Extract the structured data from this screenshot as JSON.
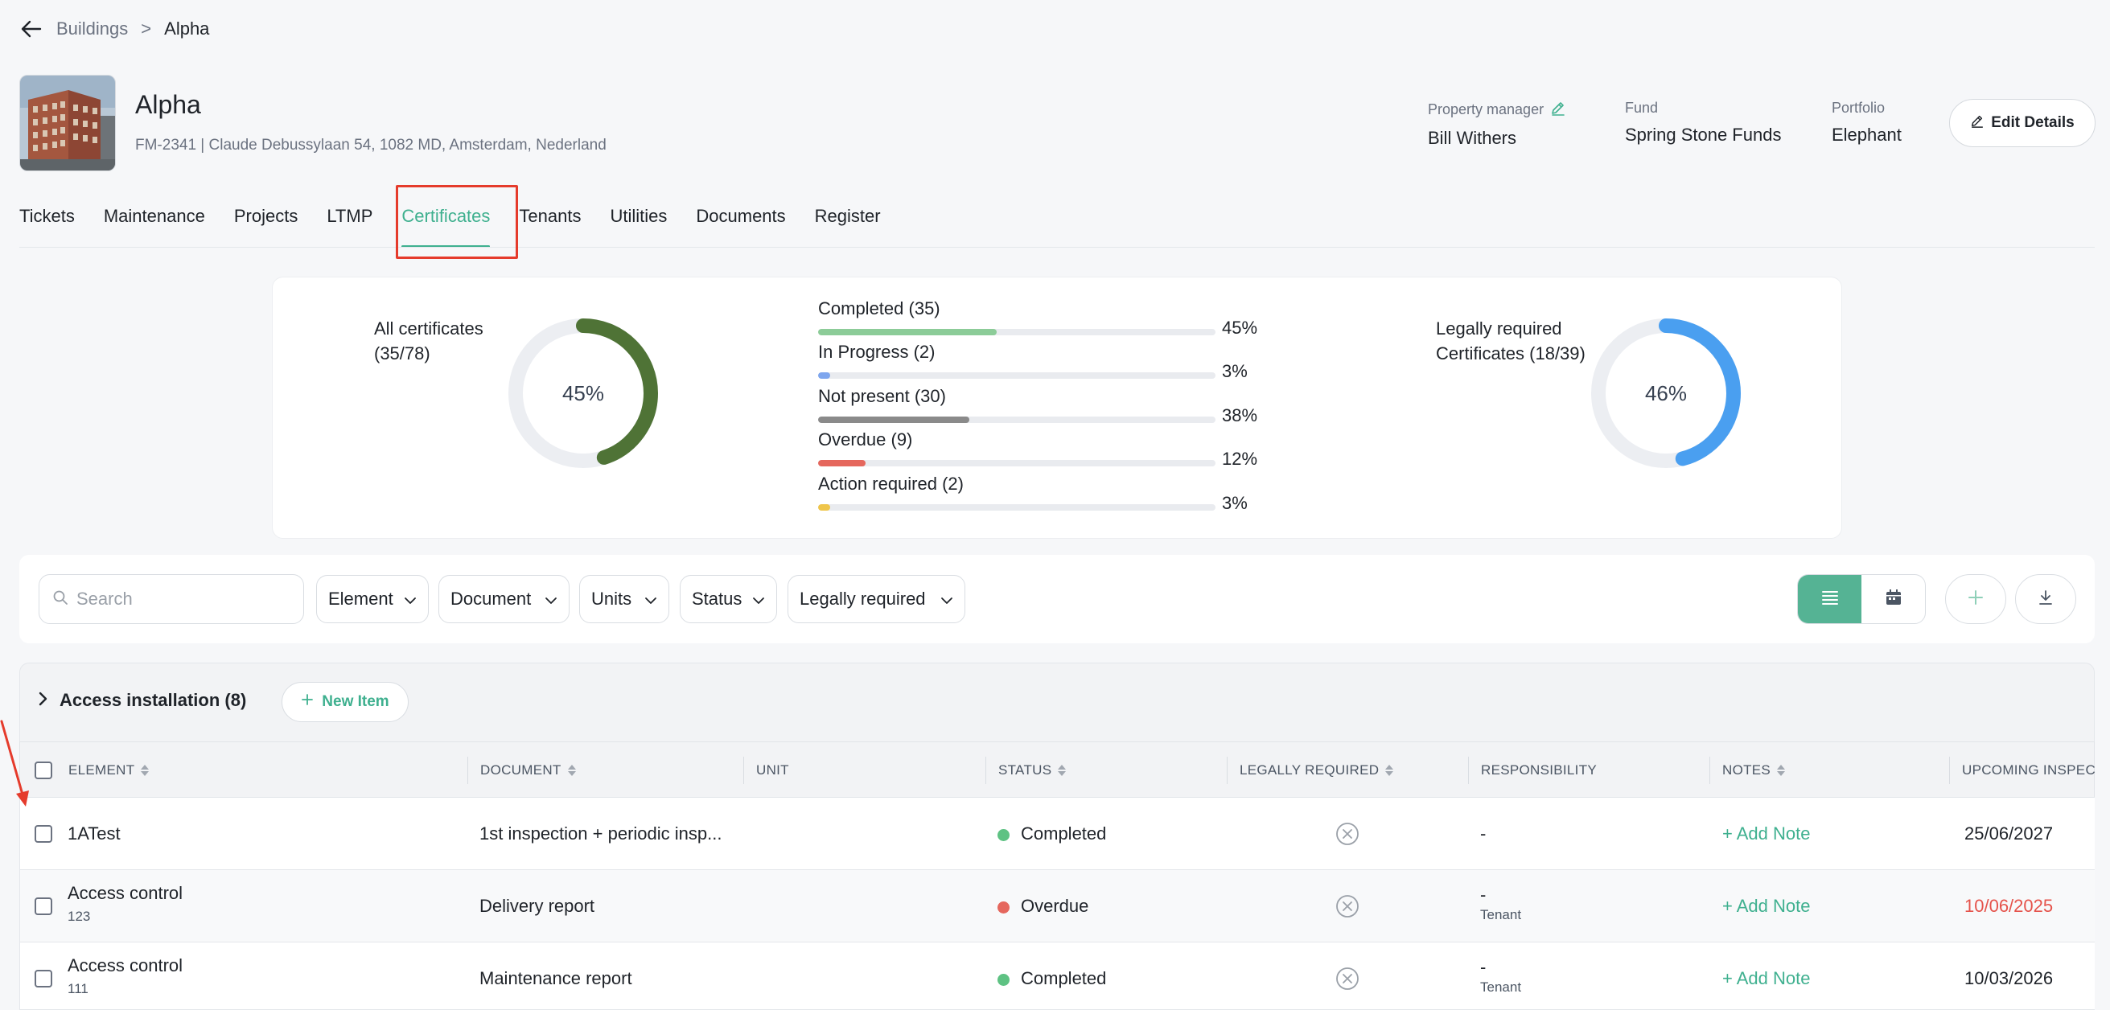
{
  "breadcrumb": {
    "parent": "Buildings",
    "separator": ">",
    "current": "Alpha"
  },
  "building": {
    "name": "Alpha",
    "subtitle": "FM-2341 | Claude Debussylaan 54, 1082 MD, Amsterdam, Nederland"
  },
  "meta": {
    "manager_label": "Property manager",
    "manager_value": "Bill Withers",
    "fund_label": "Fund",
    "fund_value": "Spring Stone Funds",
    "portfolio_label": "Portfolio",
    "portfolio_value": "Elephant"
  },
  "edit_label": "Edit Details",
  "tabs": [
    "Tickets",
    "Maintenance",
    "Projects",
    "LTMP",
    "Certificates",
    "Tenants",
    "Utilities",
    "Documents",
    "Register"
  ],
  "active_tab": "Certificates",
  "stats": {
    "all_label_1": "All certificates",
    "all_label_2": "(35/78)",
    "all_percent": "45%",
    "all_fraction": 0.45,
    "legal_label_1": "Legally required",
    "legal_label_2": "Certificates (18/39)",
    "legal_percent": "46%",
    "legal_fraction": 0.46,
    "colors": {
      "all": "#4f7336",
      "legal": "#4a9ff0",
      "ring": "#eceef2"
    },
    "bars": [
      {
        "label": "Completed (35)",
        "pct": "45%",
        "value": 0.45,
        "color": "#8ccc98"
      },
      {
        "label": "In Progress (2)",
        "pct": "3%",
        "value": 0.03,
        "color": "#7ea6ee"
      },
      {
        "label": "Not present (30)",
        "pct": "38%",
        "value": 0.38,
        "color": "#8a8a8a"
      },
      {
        "label": "Overdue (9)",
        "pct": "12%",
        "value": 0.12,
        "color": "#e5675d"
      },
      {
        "label": "Action required (2)",
        "pct": "3%",
        "value": 0.03,
        "color": "#efc54a"
      }
    ]
  },
  "filters": {
    "search_placeholder": "Search",
    "element": "Element",
    "document": "Document",
    "units": "Units",
    "status": "Status",
    "legal": "Legally required"
  },
  "group": {
    "title": "Access installation (8)",
    "new_item": "New Item"
  },
  "columns": {
    "element": "ELEMENT",
    "document": "DOCUMENT",
    "unit": "UNIT",
    "status": "STATUS",
    "legal": "LEGALLY REQUIRED",
    "responsibility": "RESPONSIBILITY",
    "notes": "NOTES",
    "upcoming": "UPCOMING INSPECTION"
  },
  "rows": [
    {
      "element": "1ATest",
      "element_sub": "",
      "document": "1st inspection + periodic insp...",
      "unit": "",
      "status": "Completed",
      "status_color": "#5ec283",
      "responsibility": "-",
      "responsibility_sub": "",
      "note": "+ Add Note",
      "upcoming": "25/06/2027",
      "upcoming_overdue": false
    },
    {
      "element": "Access control",
      "element_sub": "123",
      "document": "Delivery report",
      "unit": "",
      "status": "Overdue",
      "status_color": "#e5675d",
      "responsibility": "-",
      "responsibility_sub": "Tenant",
      "note": "+ Add Note",
      "upcoming": "10/06/2025",
      "upcoming_overdue": true
    },
    {
      "element": "Access control",
      "element_sub": "111",
      "document": "Maintenance report",
      "unit": "",
      "status": "Completed",
      "status_color": "#5ec283",
      "responsibility": "-",
      "responsibility_sub": "Tenant",
      "note": "+ Add Note",
      "upcoming": "10/03/2026",
      "upcoming_overdue": false
    }
  ]
}
